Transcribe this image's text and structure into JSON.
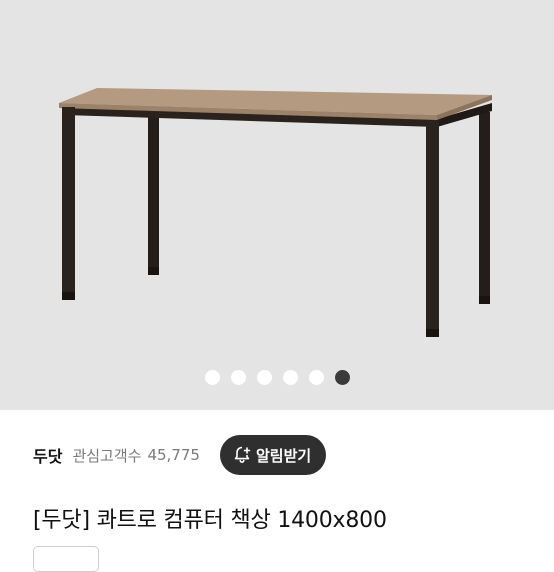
{
  "gallery": {
    "image_alt": "quatro computer desk",
    "image_count": 6,
    "active_index": 5
  },
  "brand": {
    "name": "두닷",
    "favorites_label": "관심고객수",
    "favorites_count": "45,775"
  },
  "alarm_button": {
    "label": "알림받기",
    "icon": "bell-plus-icon"
  },
  "product": {
    "title": "[두닷] 콰트로 컴퓨터 책상 1400x800"
  },
  "colors": {
    "hero_bg": "#e4e4e4",
    "desk_top": "#b49a80",
    "desk_frame": "#2a221d",
    "button_bg": "#2f2f2f",
    "dot_active": "#3a3a3a"
  }
}
